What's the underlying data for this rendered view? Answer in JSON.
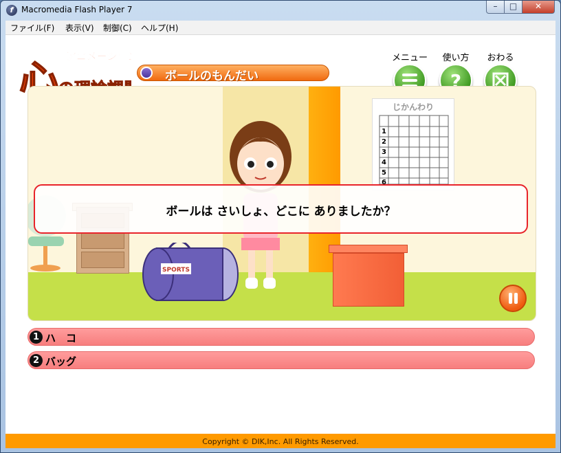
{
  "window": {
    "title": "Macromedia Flash Player 7"
  },
  "menubar": {
    "items": [
      "ファイル(F)",
      "表示(V)",
      "制御(C)",
      "ヘルプ(H)"
    ]
  },
  "logo": {
    "subtitle": "アニメーション版",
    "title": "心の理論課題"
  },
  "header": {
    "question_title": "ボールのもんだい",
    "buttons": [
      {
        "label": "メニュー",
        "icon": "menu-lines-icon"
      },
      {
        "label": "使い方",
        "icon": "question-mark-icon"
      },
      {
        "label": "おわる",
        "icon": "close-x-icon"
      }
    ]
  },
  "scene": {
    "timetable_title": "じかんわり",
    "timetable_rows": [
      "1",
      "2",
      "3",
      "4",
      "5",
      "6"
    ],
    "bag_label": "SPORTS"
  },
  "question": {
    "text": "ボールは さいしょ、どこに ありましたか？"
  },
  "answers": [
    {
      "num": "1",
      "label": "ハ　コ"
    },
    {
      "num": "2",
      "label": "バッグ"
    }
  ],
  "footer": {
    "copyright": "Copyright © DIK,Inc. All Rights Reserved."
  },
  "colors": {
    "accent_orange": "#ff9a00",
    "answer_pink": "#f77e7e",
    "question_border": "#e8232a",
    "button_green": "#3f9a22"
  }
}
